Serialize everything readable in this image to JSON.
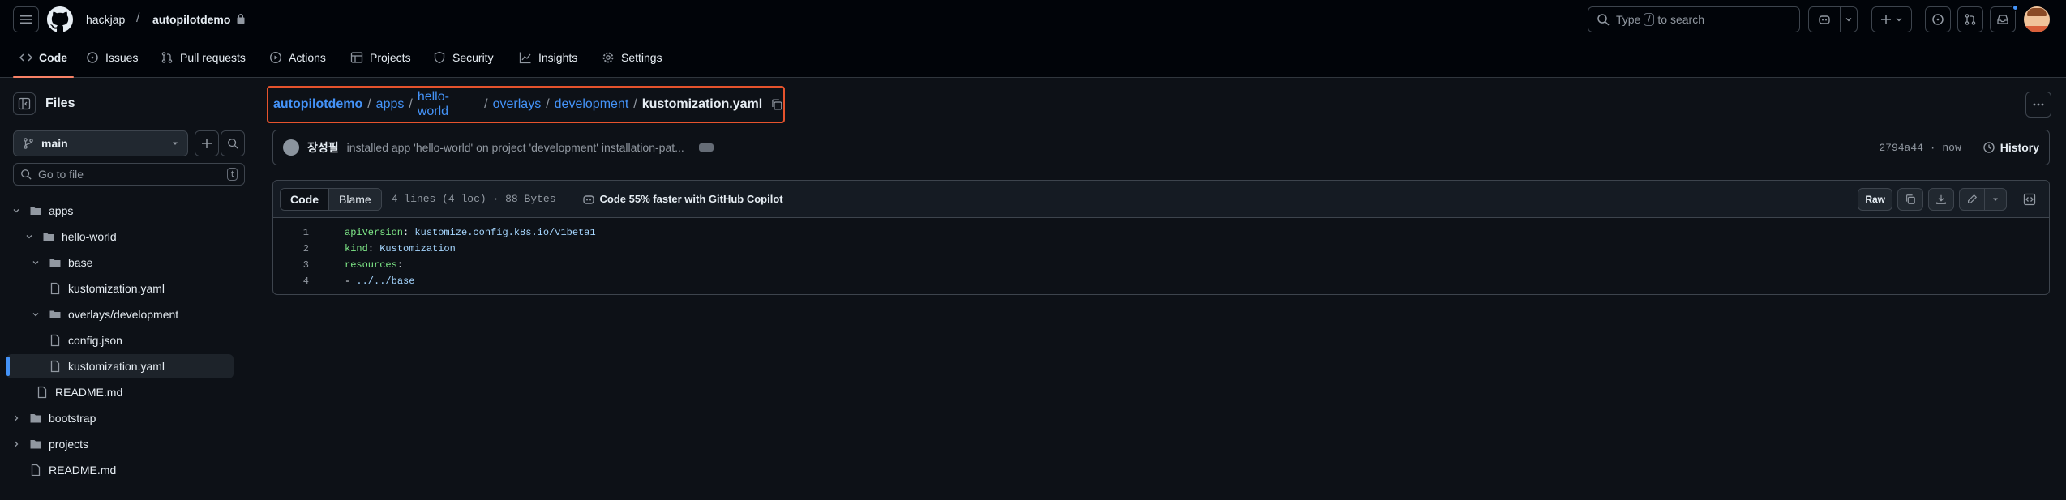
{
  "header": {
    "owner": "hackjap",
    "separator": "/",
    "repo": "autopilotdemo",
    "search_prefix": "Type",
    "search_key": "/",
    "search_suffix": "to search"
  },
  "nav": {
    "tabs": [
      {
        "label": "Code",
        "icon": "code-icon"
      },
      {
        "label": "Issues",
        "icon": "issue-icon"
      },
      {
        "label": "Pull requests",
        "icon": "pull-request-icon"
      },
      {
        "label": "Actions",
        "icon": "play-icon"
      },
      {
        "label": "Projects",
        "icon": "table-icon"
      },
      {
        "label": "Security",
        "icon": "shield-icon"
      },
      {
        "label": "Insights",
        "icon": "graph-icon"
      },
      {
        "label": "Settings",
        "icon": "gear-icon"
      }
    ]
  },
  "sidebar": {
    "title": "Files",
    "branch": "main",
    "goto_placeholder": "Go to file",
    "goto_key": "t",
    "tree": [
      {
        "label": "apps",
        "type": "folder-open"
      },
      {
        "label": "hello-world",
        "type": "folder-open"
      },
      {
        "label": "base",
        "type": "folder-open"
      },
      {
        "label": "kustomization.yaml",
        "type": "file"
      },
      {
        "label": "overlays/development",
        "type": "folder-open"
      },
      {
        "label": "config.json",
        "type": "file"
      },
      {
        "label": "kustomization.yaml",
        "type": "file"
      },
      {
        "label": "README.md",
        "type": "file"
      },
      {
        "label": "bootstrap",
        "type": "folder"
      },
      {
        "label": "projects",
        "type": "folder"
      },
      {
        "label": "README.md",
        "type": "file"
      }
    ]
  },
  "breadcrumb": {
    "parts": [
      "autopilotdemo",
      "apps",
      "hello-world",
      "overlays",
      "development"
    ],
    "current": "kustomization.yaml",
    "sep": "/"
  },
  "commit": {
    "author": "장성필",
    "message": "installed app 'hello-world' on project 'development' installation-pat...",
    "meta": "2794a44 · now",
    "history_label": "History"
  },
  "file": {
    "tab_code": "Code",
    "tab_blame": "Blame",
    "meta": "4 lines (4 loc) · 88 Bytes",
    "copilot": "Code 55% faster with GitHub Copilot",
    "raw_label": "Raw",
    "lines": [
      {
        "n": "1",
        "key": "apiVersion",
        "sep": ": ",
        "val": "kustomize.config.k8s.io/v1beta1"
      },
      {
        "n": "2",
        "key": "kind",
        "sep": ": ",
        "val": "Kustomization"
      },
      {
        "n": "3",
        "key": "resources",
        "sep": ":",
        "val": ""
      },
      {
        "n": "4",
        "key": "",
        "sep": "- ",
        "val": "../../base"
      }
    ]
  },
  "colors": {
    "accent": "#4493f8",
    "highlight_border": "#e5532d",
    "tab_underline": "#f78166"
  }
}
